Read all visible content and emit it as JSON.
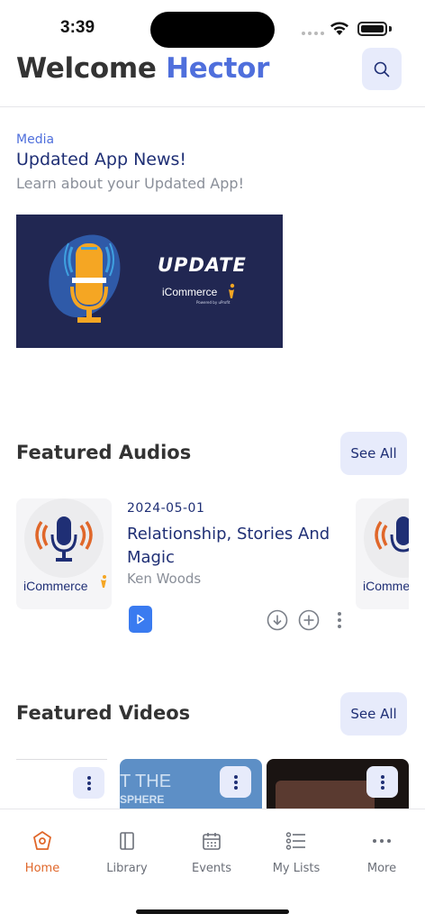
{
  "status_bar": {
    "time": "3:39"
  },
  "header": {
    "welcome_prefix": "Welcome",
    "user_name": "Hector",
    "search_icon": "search-icon"
  },
  "media": {
    "category": "Media",
    "title": "Updated App News!",
    "subtitle": "Learn about your Updated App!",
    "banner": {
      "headline": "UPDATE",
      "brand": "iCommerce",
      "brand_sub": "Powered by uProfit"
    }
  },
  "featured_audios": {
    "title": "Featured Audios",
    "see_all": "See All",
    "item": {
      "date": "2024-05-01",
      "title": "Relationship, Stories And Magic",
      "artist": "Ken Woods",
      "thumb_brand": "iCommerce"
    },
    "next_thumb_brand": "iComme"
  },
  "featured_videos": {
    "title": "Featured Videos",
    "see_all": "See All",
    "card2_text_1": "T THE",
    "card2_text_2": "SPHERE"
  },
  "tabs": [
    {
      "label": "Home",
      "icon": "home-icon",
      "active": true
    },
    {
      "label": "Library",
      "icon": "library-icon",
      "active": false
    },
    {
      "label": "Events",
      "icon": "calendar-icon",
      "active": false
    },
    {
      "label": "My Lists",
      "icon": "list-icon",
      "active": false
    },
    {
      "label": "More",
      "icon": "more-icon",
      "active": false
    }
  ],
  "colors": {
    "accent": "#4f6fdc",
    "navy": "#1f2f75",
    "active_tab": "#e0672a",
    "play_button": "#3a7bf0",
    "banner_bg": "#212752"
  }
}
